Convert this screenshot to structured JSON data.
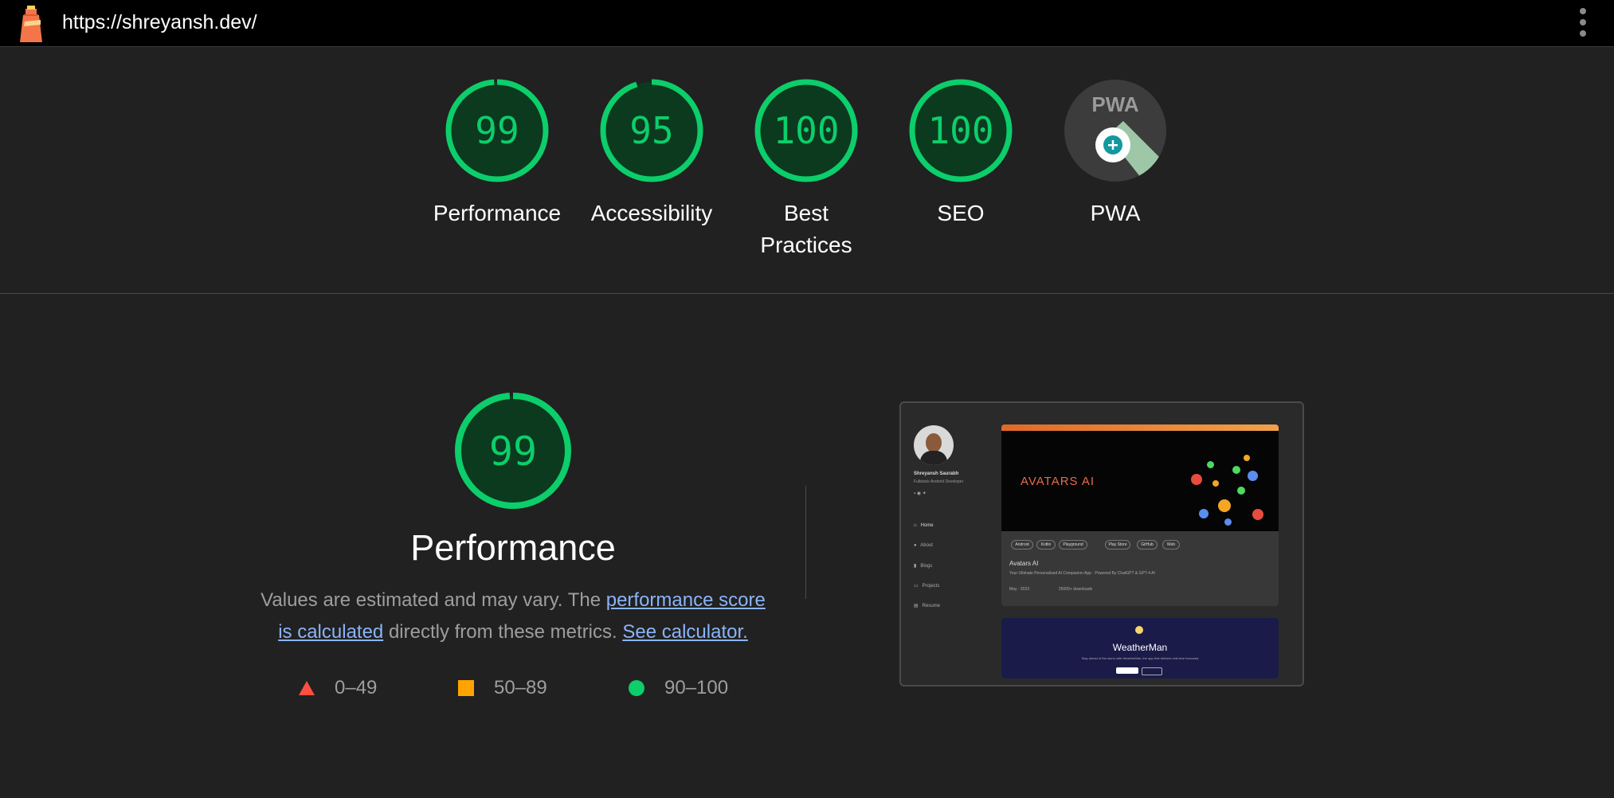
{
  "browser": {
    "url": "https://shreyansh.dev/",
    "logo_icon": "lighthouse-icon",
    "menu_icon": "kebab-menu-icon"
  },
  "scores": [
    {
      "label": "Performance",
      "value": "99",
      "fraction": 0.99
    },
    {
      "label": "Accessibility",
      "value": "95",
      "fraction": 0.95
    },
    {
      "label": "Best Practices",
      "value": "100",
      "fraction": 1.0
    },
    {
      "label": "SEO",
      "value": "100",
      "fraction": 1.0
    },
    {
      "label": "PWA",
      "value": "",
      "icon": "pwa-badge-icon"
    }
  ],
  "performance": {
    "score": "99",
    "fraction": 0.99,
    "title": "Performance",
    "desc_prefix": "Values are estimated and may vary. The ",
    "link1": "performance score is calculated",
    "desc_middle": " directly from these metrics. ",
    "link2": "See calculator."
  },
  "legend": [
    {
      "range": "0–49",
      "shape": "triangle",
      "color": "#ff4e42"
    },
    {
      "range": "50–89",
      "shape": "square",
      "color": "#ffa400"
    },
    {
      "range": "90–100",
      "shape": "circle",
      "color": "#0cce6b"
    }
  ],
  "screenshot": {
    "name": "Shreyansh Saurabh",
    "role": "Fullstack Android Developer",
    "nav": [
      "Home",
      "About",
      "Blogs",
      "Projects",
      "Resume"
    ],
    "hero_title": "AVATARS AI",
    "tags": [
      "Android",
      "Kotlin",
      "Playground",
      "Play Store",
      "GitHub",
      "Web"
    ],
    "project_title": "Avatars AI",
    "project_sub": "Your Ultimate Personalised AI Companion App · Powered By ChatGPT & GPT-4 AI",
    "project_date": "May · 2023",
    "project_downloads": "25000+ downloads",
    "second_project": "WeatherMan",
    "second_sub": "Stay ahead of the storm with WeatherMan, the app that delivers real-time forecasts"
  },
  "colors": {
    "pass": "#0cce6b",
    "pass_bg": "#0b3a1f",
    "link": "#8ab4f8"
  }
}
